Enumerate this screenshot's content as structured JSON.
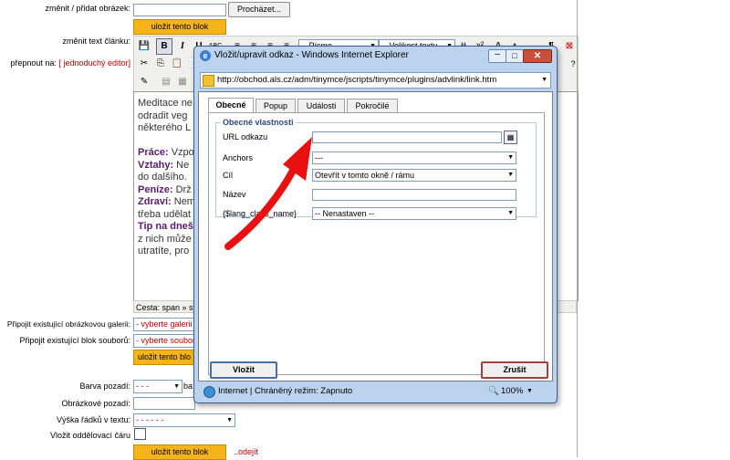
{
  "form": {
    "label_image": "změnit / přidat obrázek:",
    "browse_button": "Procházet...",
    "save_block_button": "uložit tento blok",
    "label_text": "změnit text článku:",
    "label_switch": "přepnout na:",
    "switch_link": "[ jednoduchý editor]",
    "font_select": "-- Písmo --",
    "size_select": "-- Velikost textu --",
    "path_label": "Cesta: span » str",
    "label_gallery": "Připojit existující obrázkovou galerii:",
    "gallery_select": "- vyberte galerii -",
    "label_files": "Připojit existující blok souborů:",
    "files_select": "- vyberte soubor",
    "save_block_button_2": "uložit tento blo",
    "label_bgcolor": "Barva pozadí:",
    "bgcolor_select": "- - -",
    "bgcolor_suffix": "ba",
    "label_bgimage": "Obrázkové pozadí:",
    "label_lineheight": "Výška řádků v textu:",
    "lineheight_select": "- - - - - -",
    "label_divider": "Vložit oddělovací čáru",
    "save_block_button_3": "uložit tento blok",
    "remove_link": "..odejít"
  },
  "editor": {
    "lines": [
      {
        "bold": "",
        "text": "Meditace ne"
      },
      {
        "bold": "",
        "text": "odradit veg"
      },
      {
        "bold": "",
        "text": "některého L"
      },
      {
        "bold": "",
        "text": ""
      },
      {
        "bold": "Práce:",
        "text": " Vzpo"
      },
      {
        "bold": "Vztahy:",
        "text": " Ne"
      },
      {
        "bold": "",
        "text": "do dalšího."
      },
      {
        "bold": "Peníze:",
        "text": " Drž"
      },
      {
        "bold": "Zdraví:",
        "text": " Nem"
      },
      {
        "bold": "",
        "text": "třeba udělat"
      },
      {
        "bold": "Tip na dneš",
        "text": ""
      },
      {
        "bold": "",
        "text": "z nich může"
      },
      {
        "bold": "",
        "text": "utratíte, pro"
      }
    ]
  },
  "dialog": {
    "title": "Vložit/upravit odkaz - Windows Internet Explorer",
    "address": "http://obchod.als.cz/adm/tinymce/jscripts/tinymce/plugins/advlink/link.htm",
    "tabs": [
      "Obecné",
      "Popup",
      "Události",
      "Pokročilé"
    ],
    "fieldset_legend": "Obecné vlastnosti",
    "url_label": "URL odkazu",
    "url_value": "",
    "anchors_label": "Anchors",
    "anchors_value": "---",
    "target_label": "Cíl",
    "target_value": "Otevřít v tomto okně / rámu",
    "name_label": "Název",
    "name_value": "",
    "class_label": "{$lang_class_name}",
    "class_value": "-- Nenastaven --",
    "insert_button": "Vložit",
    "cancel_button": "Zrušit",
    "status_text": "Internet | Chráněný režim: Zapnuto",
    "zoom": "100%"
  },
  "colors": {
    "accent_orange": "#f5b419",
    "arrow_red": "#e81010",
    "link_red": "#c00000",
    "dialog_frame": "#bcd3ee"
  }
}
